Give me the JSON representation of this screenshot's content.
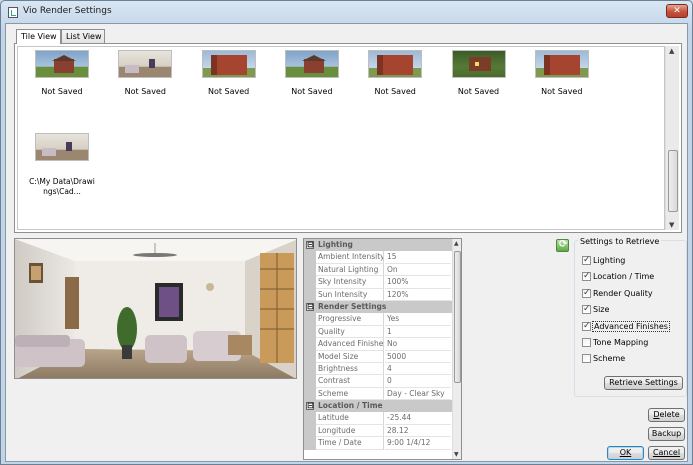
{
  "window": {
    "title": "Vio Render Settings",
    "close_glyph": "✕"
  },
  "tabs": [
    {
      "label": "Tile View",
      "active": true
    },
    {
      "label": "List View",
      "active": false
    }
  ],
  "tiles": [
    {
      "label": "Not Saved",
      "thumb": "house-exterior"
    },
    {
      "label": "Not Saved",
      "thumb": "interior-living"
    },
    {
      "label": "Not Saved",
      "thumb": "brick-corner"
    },
    {
      "label": "Not Saved",
      "thumb": "house-exterior"
    },
    {
      "label": "Not Saved",
      "thumb": "brick-corner"
    },
    {
      "label": "Not Saved",
      "thumb": "house-night"
    },
    {
      "label": "Not Saved",
      "thumb": "brick-corner"
    },
    {
      "label": "C:\\My Data\\Drawings\\Cad...",
      "thumb": "interior-living"
    }
  ],
  "property_grid": {
    "categories": [
      {
        "name": "Lighting",
        "rows": [
          {
            "name": "Ambient Intensity",
            "value": "15"
          },
          {
            "name": "Natural Lighting",
            "value": "On"
          },
          {
            "name": "Sky Intensity",
            "value": "100%"
          },
          {
            "name": "Sun Intensity",
            "value": "120%"
          }
        ]
      },
      {
        "name": "Render Settings",
        "rows": [
          {
            "name": "Progressive",
            "value": "Yes"
          },
          {
            "name": "Quality",
            "value": "1"
          },
          {
            "name": "Advanced Finishes",
            "value": "No"
          },
          {
            "name": "Model Size",
            "value": "5000"
          },
          {
            "name": "Brightness",
            "value": "4"
          },
          {
            "name": "Contrast",
            "value": "0"
          },
          {
            "name": "Scheme",
            "value": "Day - Clear Sky"
          }
        ]
      },
      {
        "name": "Location / Time",
        "rows": [
          {
            "name": "Latitude",
            "value": "-25.44"
          },
          {
            "name": "Longitude",
            "value": "28.12"
          },
          {
            "name": "Time / Date",
            "value": "9:00 1/4/12"
          }
        ]
      }
    ]
  },
  "settings_to_retrieve": {
    "title": "Settings to Retrieve",
    "items": [
      {
        "label": "Lighting",
        "checked": true
      },
      {
        "label": "Location / Time",
        "checked": true
      },
      {
        "label": "Render Quality",
        "checked": true
      },
      {
        "label": "Size",
        "checked": true
      },
      {
        "label": "Advanced Finishes",
        "checked": true
      },
      {
        "label": "Tone Mapping",
        "checked": false
      },
      {
        "label": "Scheme",
        "checked": false
      }
    ],
    "retrieve_label": "Retrieve Settings"
  },
  "buttons": {
    "delete": "Delete",
    "backup": "Backup",
    "ok": "OK",
    "cancel": "Cancel"
  },
  "icons": {
    "refresh": "refresh-icon",
    "collapse": "⊟"
  }
}
